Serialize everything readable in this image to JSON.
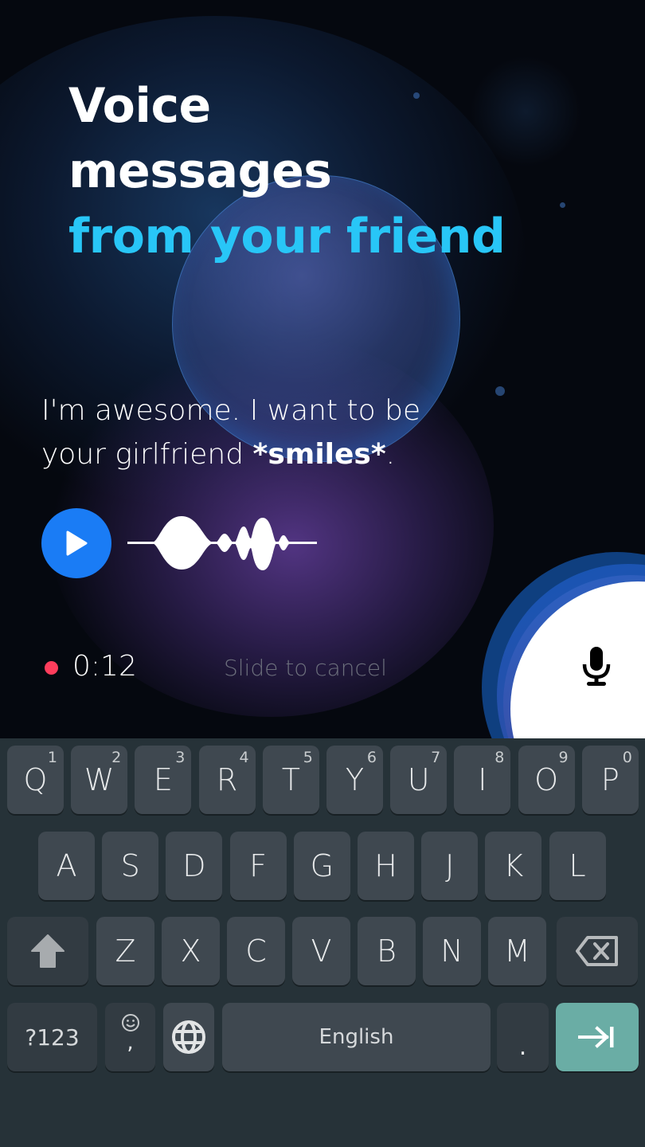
{
  "headline": {
    "line1": "Voice",
    "line2": "messages",
    "line3": "from your friend"
  },
  "message": {
    "text_part1": "I'm awesome. I want to be your girlfriend ",
    "text_bold": "*smiles*",
    "text_part2": "."
  },
  "voice_message": {
    "play_icon": "play-icon",
    "waveform_icon": "audio-waveform"
  },
  "recording": {
    "indicator_color": "#ff3d5c",
    "timer": "0:12",
    "slide_to_cancel": "Slide to cancel",
    "mic_icon": "microphone-icon"
  },
  "colors": {
    "accent_cyan": "#28c6f7",
    "play_blue": "#1a7cf5",
    "enter_teal": "#6aada5",
    "keyboard_bg": "#263238",
    "key_bg": "#3f4850"
  },
  "keyboard": {
    "row1": [
      {
        "key": "Q",
        "hint": "1"
      },
      {
        "key": "W",
        "hint": "2"
      },
      {
        "key": "E",
        "hint": "3"
      },
      {
        "key": "R",
        "hint": "4"
      },
      {
        "key": "T",
        "hint": "5"
      },
      {
        "key": "Y",
        "hint": "6"
      },
      {
        "key": "U",
        "hint": "7"
      },
      {
        "key": "I",
        "hint": "8"
      },
      {
        "key": "O",
        "hint": "9"
      },
      {
        "key": "P",
        "hint": "0"
      }
    ],
    "row2": [
      "A",
      "S",
      "D",
      "F",
      "G",
      "H",
      "J",
      "K",
      "L"
    ],
    "row3": [
      "Z",
      "X",
      "C",
      "V",
      "B",
      "N",
      "M"
    ],
    "shift_icon": "shift-arrow-icon",
    "backspace_icon": "backspace-icon",
    "symbols_label": "?123",
    "comma_label": ",",
    "emoji_icon": "smiley-icon",
    "globe_icon": "globe-icon",
    "space_label": "English",
    "period_label": ".",
    "enter_icon": "tab-arrow-icon"
  }
}
